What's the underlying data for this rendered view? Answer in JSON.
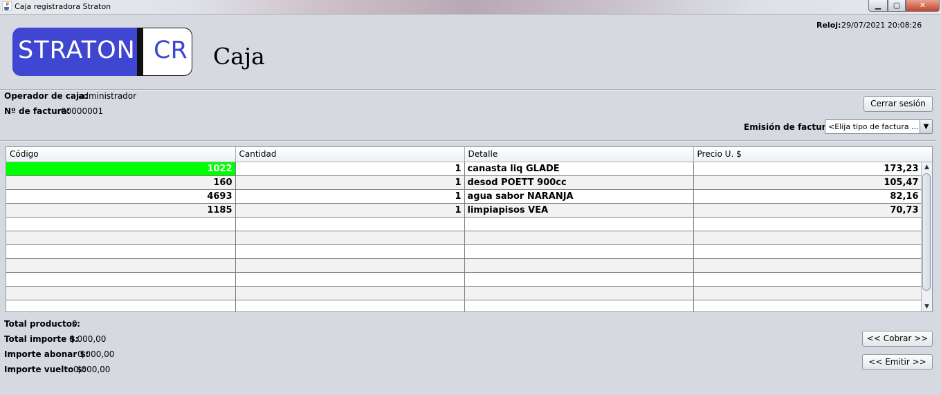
{
  "window": {
    "title": "Caja registradora Straton",
    "min_glyph": "▁",
    "max_glyph": "▢",
    "close_glyph": "✕"
  },
  "logo": {
    "left_text": "STRATON",
    "right_text": "CR",
    "brand_color": "#3f46d1"
  },
  "page_title": "Caja",
  "clock": {
    "label": "Reloj:",
    "value": "29/07/2021 20:08:26"
  },
  "operator": {
    "label": "Operador de caja:",
    "value": "administrador"
  },
  "invoice_number": {
    "label": "Nº de factura:",
    "value": "00000001"
  },
  "buttons": {
    "logout": "Cerrar sesión",
    "charge": "<<  Cobrar  >>",
    "emit": "<< Emitir >>"
  },
  "invoice_type": {
    "label": "Emisión de factura:",
    "selected": "<Elija tipo de factura ..."
  },
  "table": {
    "columns": [
      "Código",
      "Cantidad",
      "Detalle",
      "Precio U. $"
    ],
    "rows": [
      {
        "code": "1022",
        "qty": "1",
        "detail": "canasta liq GLADE",
        "price": "173,23"
      },
      {
        "code": "160",
        "qty": "1",
        "detail": "desod POETT 900cc",
        "price": "105,47"
      },
      {
        "code": "4693",
        "qty": "1",
        "detail": "agua sabor NARANJA",
        "price": "82,16"
      },
      {
        "code": "1185",
        "qty": "1",
        "detail": "limpiapisos VEA",
        "price": "70,73"
      }
    ],
    "selected_color": "#00ff00"
  },
  "totals": {
    "products": {
      "label": "Total productos:",
      "value": "0"
    },
    "amount": {
      "label": "Total importe $:",
      "value": "0.000,00"
    },
    "pay": {
      "label": "Importe abonar $:",
      "value": "0.000,00"
    },
    "change": {
      "label": "Importe vuelto $:",
      "value": "0.000,00"
    }
  }
}
